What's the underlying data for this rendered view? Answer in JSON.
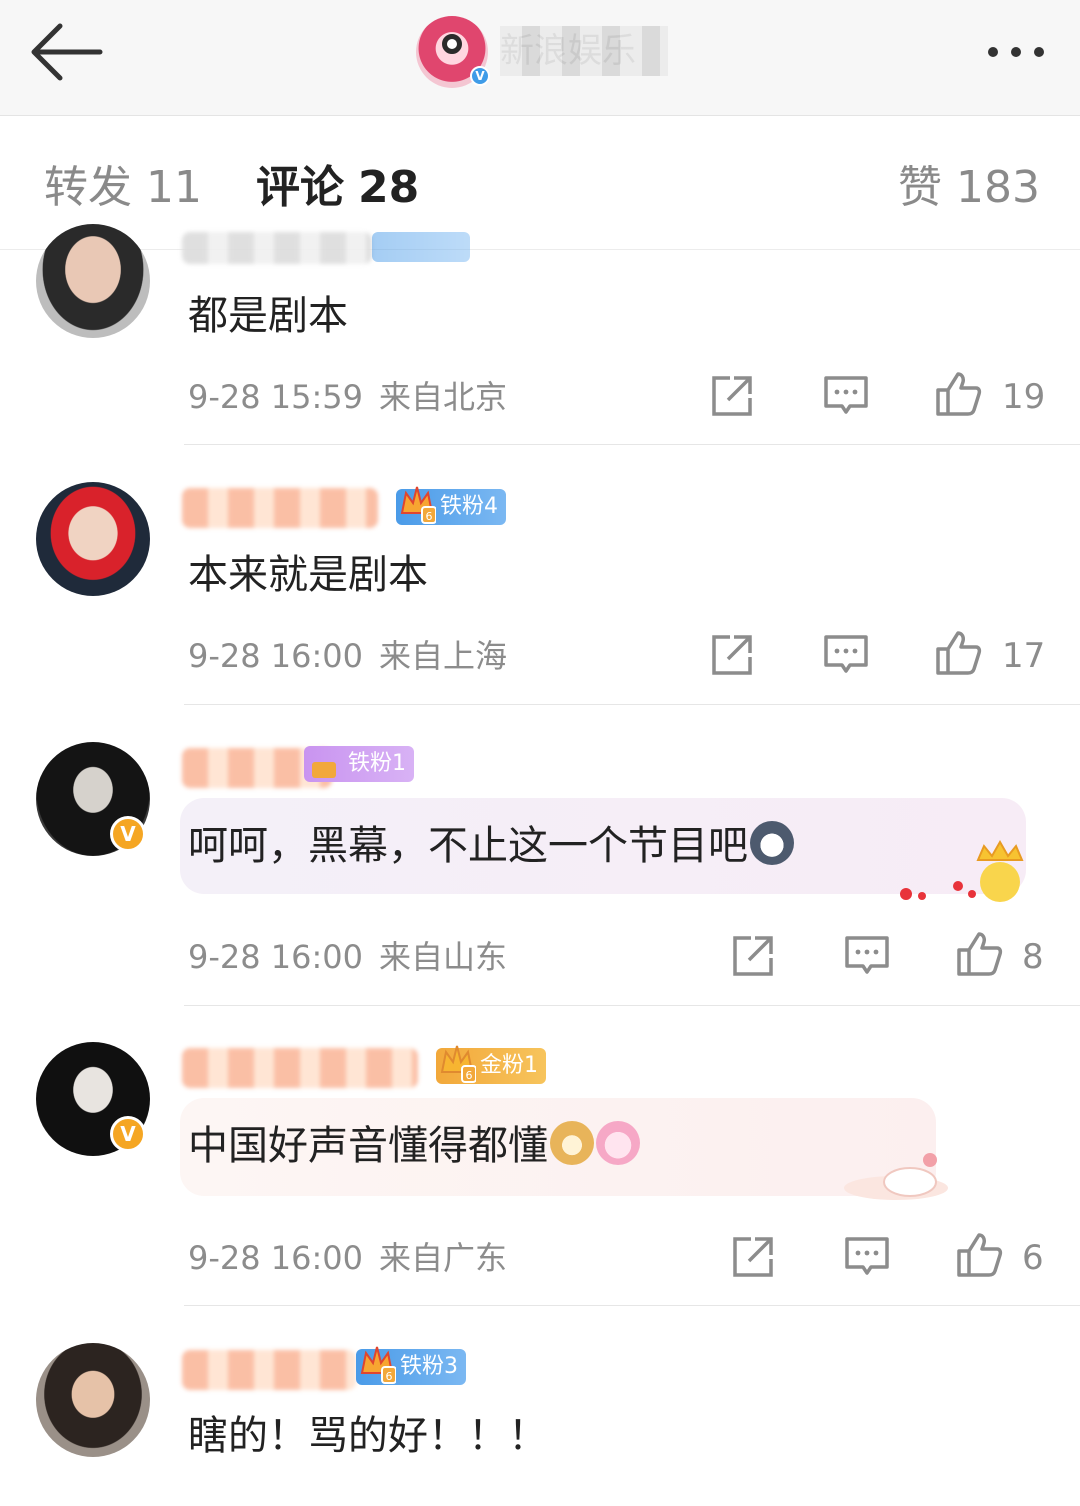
{
  "header": {
    "account_name": "新浪娱乐",
    "verified_mark": "V",
    "icons": {
      "back": "back-arrow-icon",
      "more": "more-dots-icon"
    }
  },
  "tabs": {
    "repost": {
      "label": "转发",
      "count": "11"
    },
    "comments": {
      "label": "评论",
      "count": "28"
    },
    "likes": {
      "label": "赞",
      "count": "183"
    }
  },
  "comments": [
    {
      "username": "",
      "text": "都是剧本",
      "time": "9-28 15:59",
      "location": "来自北京",
      "likes": "19"
    },
    {
      "username": "",
      "badge": "铁粉4",
      "text": "本来就是剧本",
      "time": "9-28 16:00",
      "location": "来自上海",
      "likes": "17"
    },
    {
      "username": "",
      "badge": "铁粉1",
      "text": "呵呵，黑幕，不止这一个节目吧",
      "time": "9-28 16:00",
      "location": "来自山东",
      "likes": "8",
      "verified_mark": "V"
    },
    {
      "username": "",
      "badge": "金粉1",
      "text": "中国好声音懂得都懂",
      "time": "9-28 16:00",
      "location": "来自广东",
      "likes": "6",
      "verified_mark": "V"
    },
    {
      "username": "",
      "badge": "铁粉3",
      "text": "瞎的！骂的好！！！"
    }
  ],
  "colors": {
    "topbar_bg": "#f7f7f7",
    "text_primary": "#222222",
    "text_secondary": "#8c8c8c",
    "badge_blue": "#4a9be8",
    "badge_gold": "#f2a83a",
    "verified_gold": "#f5a623"
  }
}
